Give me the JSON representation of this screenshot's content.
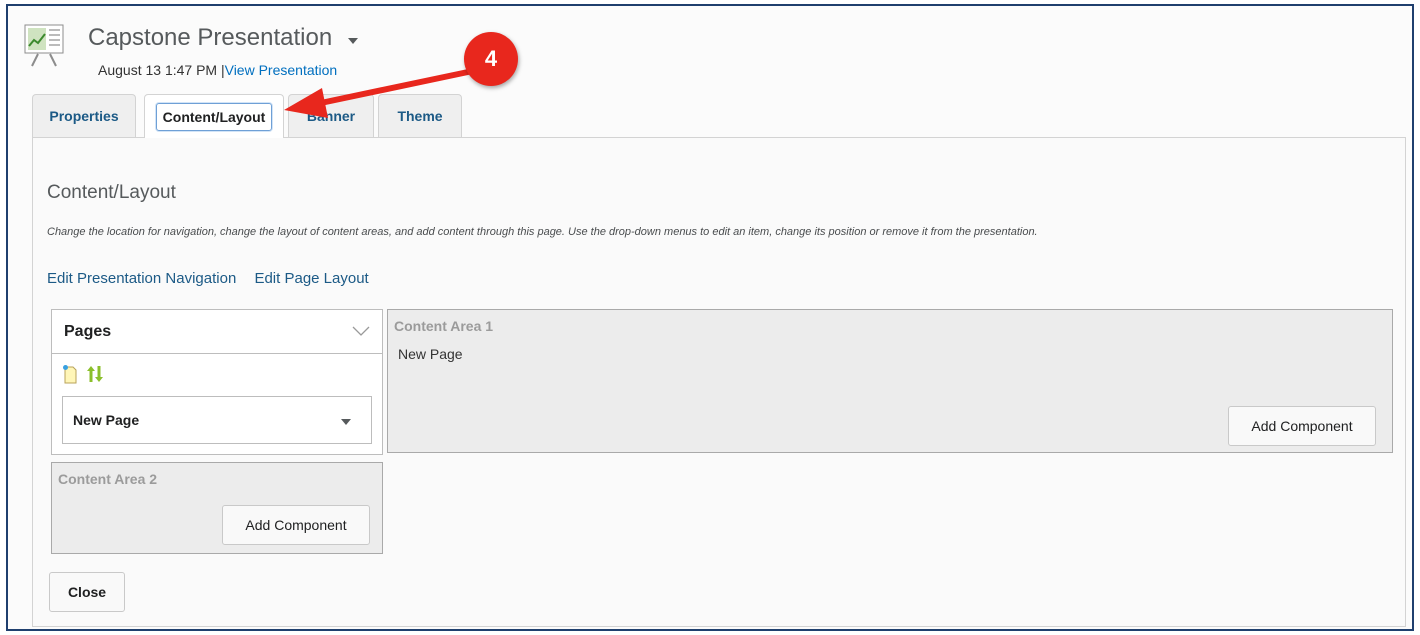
{
  "header": {
    "title": "Capstone Presentation",
    "date": "August 13 1:47 PM",
    "separator": "|",
    "view_link": "View Presentation"
  },
  "tabs": [
    {
      "label": "Properties",
      "active": false
    },
    {
      "label": "Content/Layout",
      "active": true
    },
    {
      "label": "Banner",
      "active": false
    },
    {
      "label": "Theme",
      "active": false
    }
  ],
  "content": {
    "title": "Content/Layout",
    "description": "Change the location for navigation, change the layout of content areas, and add content through this page. Use the drop-down menus to edit an item, change its position or remove it from the presentation.",
    "links": [
      "Edit Presentation Navigation",
      "Edit Page Layout"
    ]
  },
  "pages": {
    "heading": "Pages",
    "tool_icons": [
      "new-page-icon",
      "reorder-icon"
    ],
    "selected_page": "New Page"
  },
  "areas": [
    {
      "label": "Content Area 1",
      "items": [
        "New Page"
      ],
      "button": "Add Component"
    },
    {
      "label": "Content Area 2",
      "items": [],
      "button": "Add Component"
    }
  ],
  "close_label": "Close",
  "annotation": {
    "step": "4",
    "color": "#e8271d"
  }
}
